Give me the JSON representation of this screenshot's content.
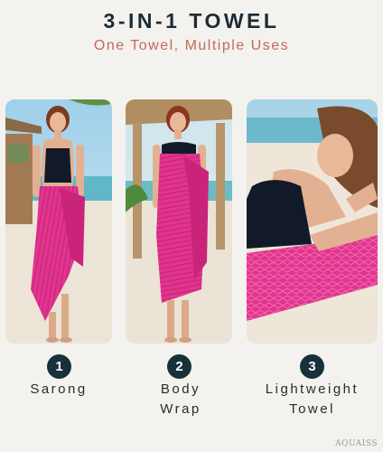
{
  "header": {
    "title": "3-IN-1 TOWEL",
    "subtitle": "One Towel, Multiple Uses"
  },
  "uses": [
    {
      "number": "1",
      "label_line1": "Sarong",
      "label_line2": ""
    },
    {
      "number": "2",
      "label_line1": "Body",
      "label_line2": "Wrap"
    },
    {
      "number": "3",
      "label_line1": "Lightweight",
      "label_line2": "Towel"
    }
  ],
  "brand": "AQUAISS",
  "colors": {
    "towel_pink": "#e2358f",
    "badge_navy": "#17303a",
    "subtitle_coral": "#c56a55"
  }
}
